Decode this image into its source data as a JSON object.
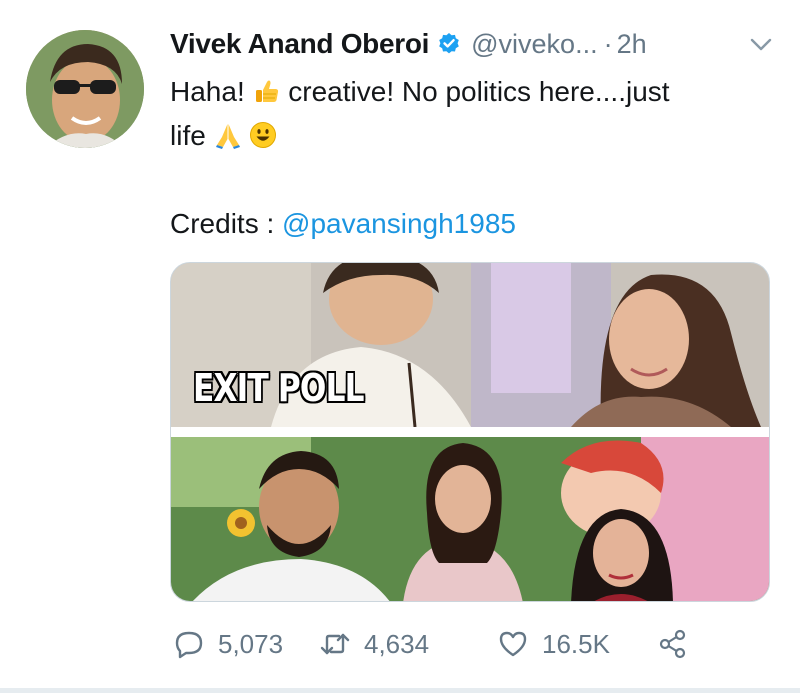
{
  "tweet": {
    "author_name": "Vivek Anand Oberoi",
    "handle": "@viveko...",
    "separator": "·",
    "time": "2h",
    "verified": true,
    "text_line1_a": "Haha! ",
    "text_line1_b": " creative! No politics here....just",
    "text_line2": "life ",
    "credits_label": "Credits : ",
    "credits_mention": "@pavansingh1985",
    "emojis": [
      "thumbs-up-icon",
      "folded-hands-icon",
      "grinning-face-icon"
    ]
  },
  "media": {
    "overlay_text": "EXIT POLL"
  },
  "actions": {
    "reply_count": "5,073",
    "retweet_count": "4,634",
    "like_count": "16.5K"
  },
  "colors": {
    "text": "#14171a",
    "secondary": "#657786",
    "link": "#1b95e0",
    "verified": "#1da1f2"
  }
}
